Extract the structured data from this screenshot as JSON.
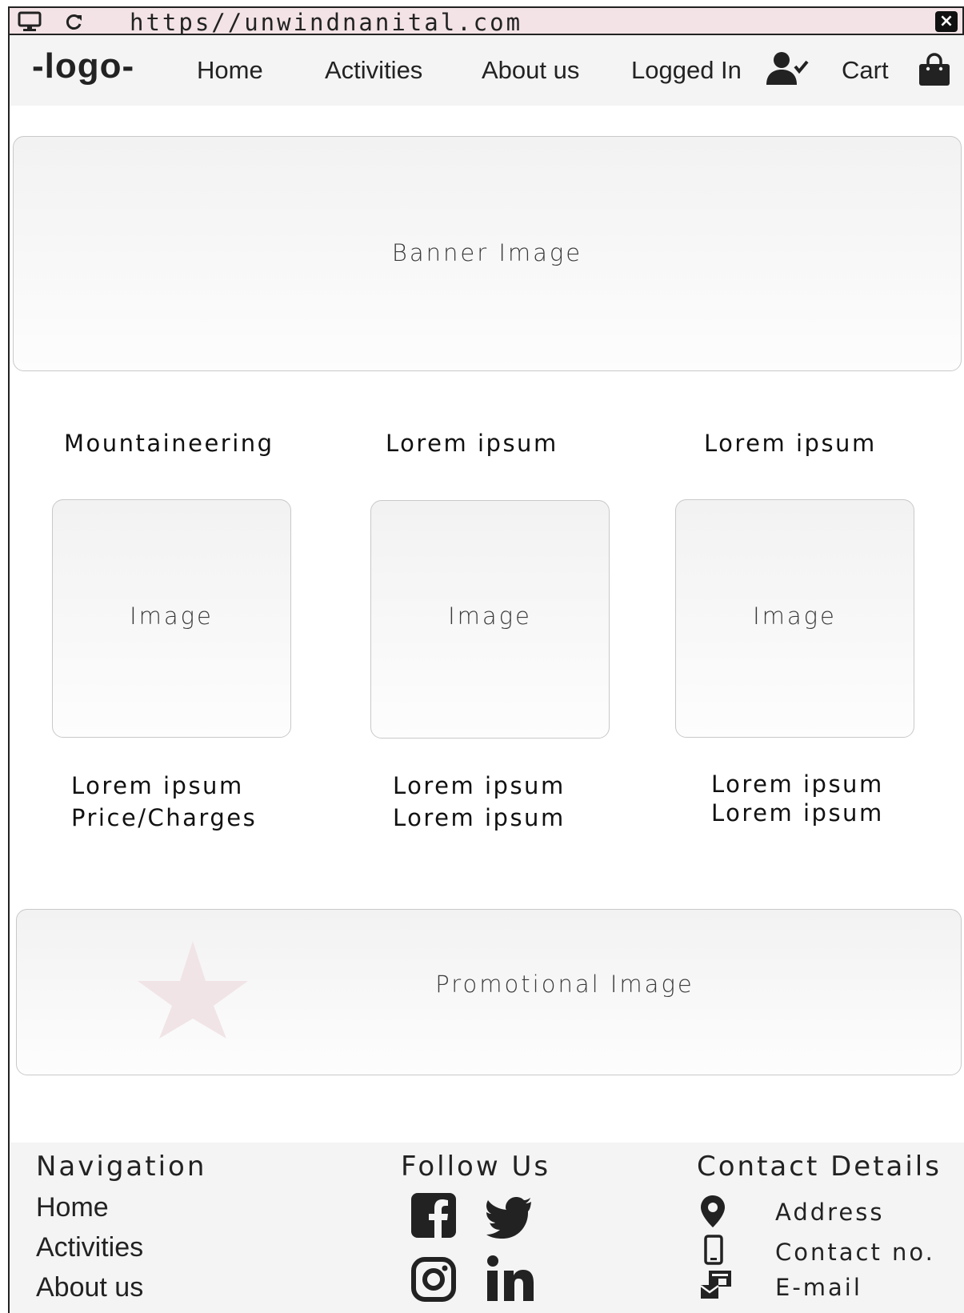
{
  "browser": {
    "url": "https//unwindnanital.com",
    "close_label": "×"
  },
  "header": {
    "logo": "-logo-",
    "nav": {
      "home": "Home",
      "activities": "Activities",
      "about": "About us",
      "logged_in": "Logged In",
      "cart": "Cart"
    }
  },
  "banner": {
    "label": "Banner Image"
  },
  "cards": [
    {
      "title": "Mountaineering",
      "image_label": "Image",
      "line1": "Lorem ipsum",
      "line2": "Price/Charges"
    },
    {
      "title": "Lorem ipsum",
      "image_label": "Image",
      "line1": "Lorem ipsum",
      "line2": "Lorem ipsum"
    },
    {
      "title": "Lorem ipsum",
      "image_label": "Image",
      "line1": "Lorem ipsum",
      "line2": "Lorem ipsum"
    }
  ],
  "promo": {
    "label": "Promotional  Image"
  },
  "footer": {
    "navigation": {
      "heading": "Navigation",
      "links": [
        "Home",
        "Activities",
        "About us"
      ]
    },
    "follow": {
      "heading": "Follow Us"
    },
    "contact": {
      "heading": "Contact Details",
      "address": "Address",
      "phone": "Contact no.",
      "email": "E-mail"
    }
  },
  "colors": {
    "browser_bar": "#f3e3e6",
    "header_bg": "#f4f4f4",
    "star": "#f1e4e6"
  }
}
